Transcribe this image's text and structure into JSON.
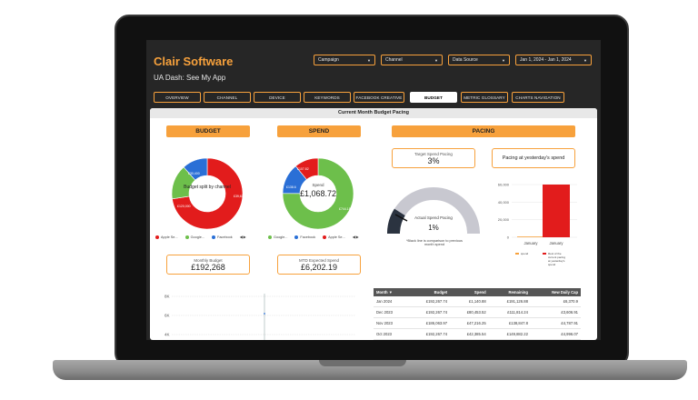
{
  "header": {
    "brand": "Clair Software",
    "subtitle": "UA Dash:  See My App"
  },
  "filters": [
    {
      "label": "Campaign"
    },
    {
      "label": "Channel"
    },
    {
      "label": "Data Source"
    },
    {
      "label": "Jan 1, 2024 - Jan 1, 2024"
    }
  ],
  "nav": [
    "OVERVIEW",
    "CHANNEL",
    "DEVICE",
    "KEYWORDS",
    "FACEBOOK CREATIVE",
    "BUDGET",
    "METRIC GLOSSARY",
    "CHARTS NAVIGATION"
  ],
  "panel_title": "Current Month Budget Pacing",
  "budget": {
    "heading": "BUDGET",
    "center_label": "Budget split by channel",
    "slice_labels": [
      "£30,400",
      "£120,000",
      "£39,638.24"
    ],
    "legend": [
      "Apple Se...",
      "Google...",
      "Facebook"
    ],
    "card_label": "Monthly Budget",
    "card_value": "£192,268"
  },
  "spend": {
    "heading": "SPEND",
    "center_label": "Spend",
    "center_value": "£1,068.72",
    "slice_labels": [
      "£107.82",
      "£138.6",
      "£744.15"
    ],
    "legend": [
      "Google...",
      "Facebook",
      "Apple Se..."
    ],
    "card_label": "MTD Expected Spend",
    "card_value": "£6,202.19"
  },
  "pacing": {
    "heading": "PACING",
    "target_label": "Target Spend Pacing",
    "target_value": "3%",
    "yesterday_label": "Pacing at yesterday's spend",
    "actual_label": "Actual Spend Pacing",
    "actual_value": "1%",
    "note": "*Black line is comparison to previous month spend"
  },
  "colors": {
    "accent": "#f7a13c",
    "red": "#e21c1c",
    "green": "#6dbf4b",
    "blue": "#2a6fd6",
    "yellow": "#f2c12e",
    "grey": "#7b7b7b"
  },
  "chart_data": [
    {
      "type": "pie",
      "title": "",
      "labels": [
        "Apple Se...",
        "Google...",
        "Facebook"
      ],
      "values": [
        139638.24,
        30400,
        22229.76
      ]
    },
    {
      "type": "pie",
      "title": "",
      "labels": [
        "Google...",
        "Facebook",
        "Apple Se..."
      ],
      "values": [
        744.15,
        138.6,
        107.82
      ]
    },
    {
      "type": "bar",
      "categories": [
        "January"
      ],
      "series": [
        {
          "name": "spend",
          "values": [
            0
          ]
        },
        {
          "name": "Rest of the current pacing at yesterday's spend",
          "values": [
            60000
          ]
        }
      ],
      "yticks": [
        "60,000",
        "40,000",
        "20,000",
        "0"
      ],
      "ylim": [
        0,
        60000
      ],
      "xtick_labels": [
        "January",
        "January"
      ]
    },
    {
      "type": "line",
      "yticks": [
        "8K",
        "6K",
        "4K"
      ]
    }
  ],
  "table": {
    "headers": [
      "Month ▼",
      "Budget",
      "Spend",
      "Remaining",
      "New Daily Cap"
    ],
    "rows": [
      [
        "Jan 2024",
        "£192,267.74",
        "£1,140.88",
        "£191,126.88",
        "£6,370.9"
      ],
      [
        "Dec 2023",
        "£192,267.74",
        "£80,453.52",
        "£111,814.24",
        "£3,606.91"
      ],
      [
        "Nov 2023",
        "£186,063.97",
        "£47,216.25",
        "£138,847.8",
        "£4,787.91"
      ],
      [
        "Oct 2023",
        "£192,267.74",
        "£42,385.54",
        "£149,882.22",
        "£4,996.07"
      ]
    ]
  }
}
